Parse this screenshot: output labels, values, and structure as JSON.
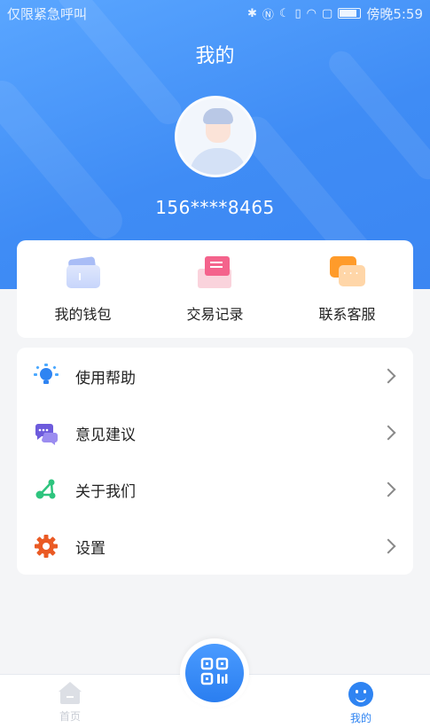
{
  "status_bar": {
    "carrier": "仅限紧急呼叫",
    "time": "傍晚5:59",
    "icons": [
      "bluetooth-icon",
      "nfc-icon",
      "moon-icon",
      "vibrate-icon",
      "wifi-icon",
      "sim-icon",
      "battery-icon"
    ]
  },
  "header": {
    "title": "我的",
    "avatar_icon": "user-avatar",
    "phone": "156****8465"
  },
  "quick_actions": [
    {
      "label": "我的钱包",
      "icon": "wallet-icon"
    },
    {
      "label": "交易记录",
      "icon": "records-icon"
    },
    {
      "label": "联系客服",
      "icon": "customer-service-icon"
    }
  ],
  "menu": [
    {
      "label": "使用帮助",
      "icon": "lightbulb-icon",
      "color": "#2f84f2"
    },
    {
      "label": "意见建议",
      "icon": "chat-bubbles-icon",
      "color": "#6d5bdc"
    },
    {
      "label": "关于我们",
      "icon": "nodes-icon",
      "color": "#2ec47e"
    },
    {
      "label": "设置",
      "icon": "gear-icon",
      "color": "#ea5a24"
    }
  ],
  "tabbar": {
    "home_label": "首页",
    "mine_label": "我的",
    "scan_icon": "qr-scan-icon"
  },
  "colors": {
    "brand": "#3f8cf5",
    "tab_active": "#2f84f2",
    "tab_inactive": "#c8ccd4"
  }
}
